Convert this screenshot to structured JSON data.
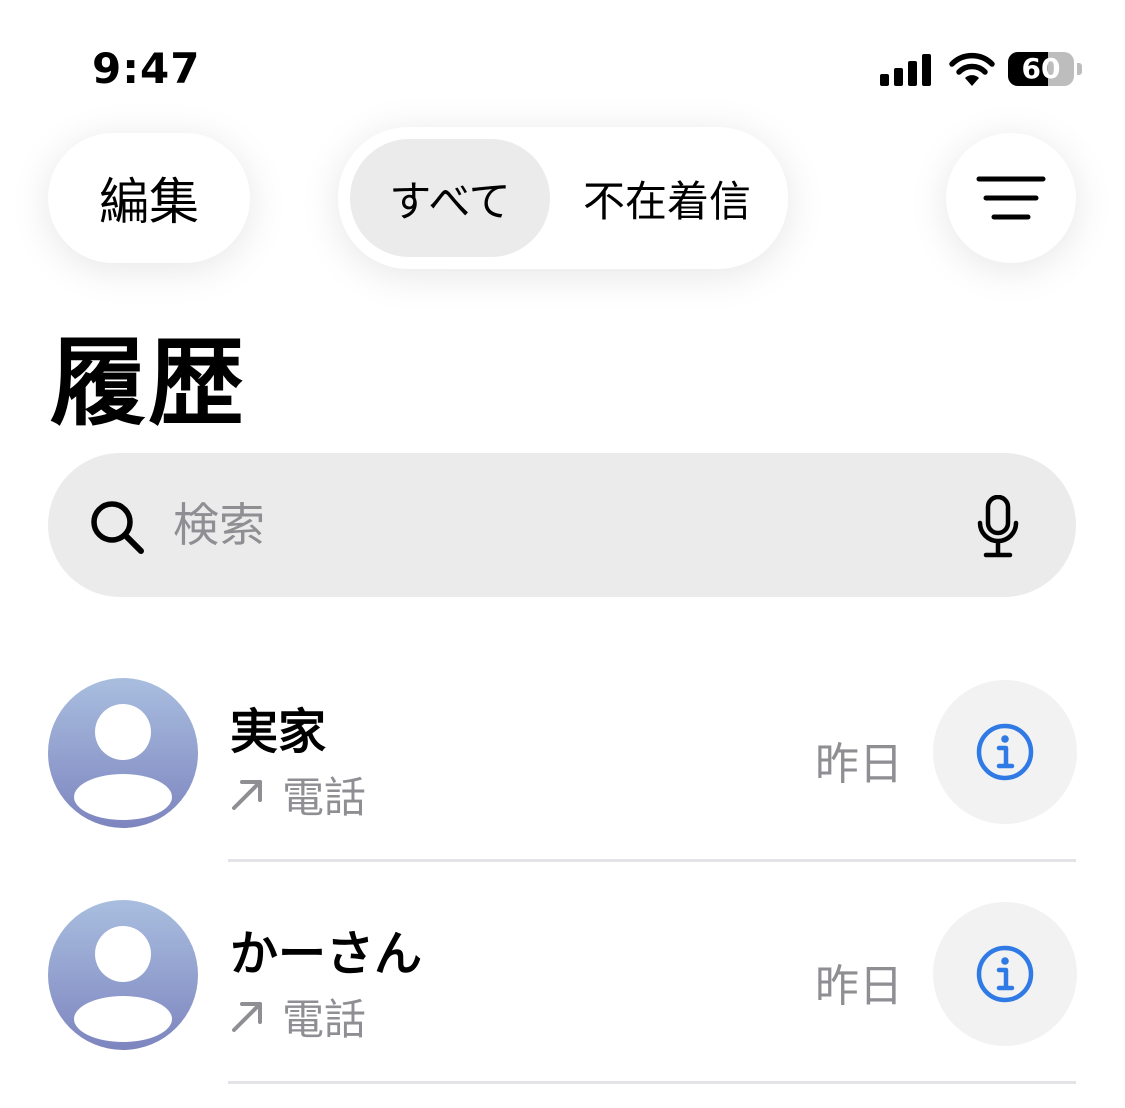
{
  "status_bar": {
    "time": "9:47",
    "battery_level": "60",
    "icons": [
      "cellular-signal-icon",
      "wifi-icon",
      "battery-icon"
    ]
  },
  "toolbar": {
    "edit_label": "編集",
    "segments": [
      {
        "label": "すべて",
        "selected": true
      },
      {
        "label": "不在着信",
        "selected": false
      }
    ],
    "filter_icon": "filter-lines-icon"
  },
  "page": {
    "title": "履歴"
  },
  "search": {
    "placeholder": "検索",
    "icon": "magnifying-glass-icon",
    "mic_icon": "microphone-icon"
  },
  "calls": [
    {
      "name": "実家",
      "type": "電話",
      "direction": "outgoing",
      "date": "昨日"
    },
    {
      "name": "かーさん",
      "type": "電話",
      "direction": "outgoing",
      "date": "昨日"
    }
  ],
  "colors": {
    "accent": "#2f7ae5",
    "secondary_text": "#8e8e93",
    "avatar_top": "#a9bedf",
    "avatar_bottom": "#7d85bf"
  }
}
